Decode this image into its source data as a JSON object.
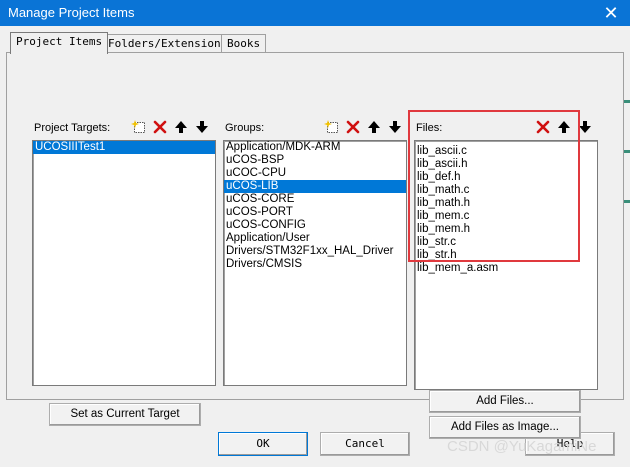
{
  "window": {
    "title": "Manage Project Items",
    "close_glyph": "✕"
  },
  "tabs": [
    {
      "label": "Project Items",
      "active": true
    },
    {
      "label": "Folders/Extensions",
      "active": false
    },
    {
      "label": "Books",
      "active": false
    }
  ],
  "targets": {
    "label": "Project Targets:",
    "items": [
      "UCOSIIITest1"
    ],
    "selected_index": 0,
    "set_current_label": "Set as Current Target"
  },
  "groups": {
    "label": "Groups:",
    "items": [
      "Application/MDK-ARM",
      "uCOS-BSP",
      "uCOC-CPU",
      "uCOS-LIB",
      "uCOS-CORE",
      "uCOS-PORT",
      "uCOS-CONFIG",
      "Application/User",
      "Drivers/STM32F1xx_HAL_Driver",
      "Drivers/CMSIS"
    ],
    "selected_index": 3
  },
  "files": {
    "label": "Files:",
    "items": [
      "lib_ascii.c",
      "lib_ascii.h",
      "lib_def.h",
      "lib_math.c",
      "lib_math.h",
      "lib_mem.c",
      "lib_mem.h",
      "lib_str.c",
      "lib_str.h",
      "lib_mem_a.asm"
    ],
    "add_files_label": "Add Files...",
    "add_files_image_label": "Add Files as Image..."
  },
  "footer": {
    "ok_label": "OK",
    "cancel_label": "Cancel",
    "help_label": "Help"
  },
  "watermark": "CSDN @YuKagamiNe",
  "colors": {
    "titlebar": "#0a74d6",
    "selection": "#0078d7",
    "highlight_box": "#e0393e",
    "delete_icon": "#d01010"
  },
  "icons": [
    "new-item-icon",
    "delete-icon",
    "move-up-icon",
    "move-down-icon"
  ]
}
